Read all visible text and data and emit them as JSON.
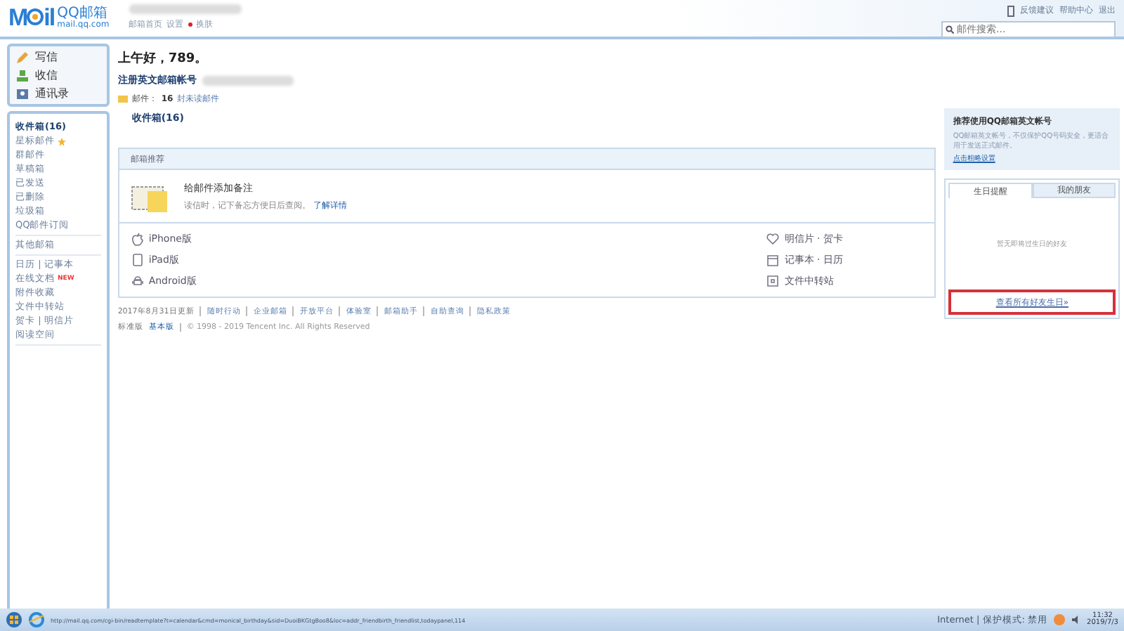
{
  "header": {
    "logo_mark": [
      "M",
      "il"
    ],
    "logo": "QQ邮箱",
    "domain": "mail.qq.com",
    "links": [
      "邮箱首页",
      "设置",
      "换肤"
    ],
    "top_links": [
      "反馈建议",
      "帮助中心",
      "退出"
    ],
    "search": {
      "placeholder": "邮件搜索..."
    }
  },
  "sidebar": {
    "actions": [
      "写信",
      "收信",
      "通讯录"
    ],
    "groups": [
      [
        {
          "label": "收件箱(16)",
          "bold": true
        },
        {
          "label": "星标邮件",
          "star": true
        },
        {
          "label": "群邮件"
        },
        {
          "label": "草稿箱"
        },
        {
          "label": "已发送"
        },
        {
          "label": "已删除"
        },
        {
          "label": "垃圾箱"
        },
        {
          "label": "QQ邮件订阅"
        }
      ],
      [
        {
          "label": "其他邮箱"
        }
      ],
      [
        {
          "label": "日历 | 记事本"
        },
        {
          "label": "在线文档",
          "badge": "NEW"
        },
        {
          "label": "附件收藏"
        },
        {
          "label": "文件中转站"
        },
        {
          "label": "贺卡 | 明信片"
        },
        {
          "label": "阅读空间"
        }
      ]
    ]
  },
  "welcome": {
    "greeting": "上午好，789。",
    "register": "注册英文邮箱帐号",
    "mail_label": "邮件：",
    "mail_count": "16",
    "unread": "封未读邮件",
    "inbox": "收件箱(16)"
  },
  "recommend": {
    "title": "邮箱推荐",
    "tip_title": "给邮件添加备注",
    "tip_text": "读信时，记下备忘方便日后查阅。",
    "tip_link": "了解详情",
    "apps": [
      {
        "label": "iPhone版",
        "kind": "phone"
      },
      {
        "label": "明信片 · 贺卡",
        "kind": "heart"
      },
      {
        "label": "iPad版",
        "kind": "tablet"
      },
      {
        "label": "记事本 · 日历",
        "kind": "calendar"
      },
      {
        "label": "Android版",
        "kind": "android"
      },
      {
        "label": "文件中转站",
        "kind": "file"
      }
    ]
  },
  "footer": {
    "links": [
      "2017年8月31日更新",
      "随时行动",
      "企业邮箱",
      "开放平台",
      "体验室",
      "邮箱助手",
      "自助查询",
      "隐私政策"
    ],
    "versions": [
      "标准版",
      "基本版"
    ],
    "copyright": "© 1998 - 2019 Tencent Inc. All Rights Reserved"
  },
  "promo": {
    "title": "推荐使用QQ邮箱英文帐号",
    "text": "QQ邮箱英文帐号，不仅保护QQ号码安全，更适合用于发送正式邮件。",
    "link": "点击粗略设置"
  },
  "birthday": {
    "tabs": [
      {
        "label": "生日提醒",
        "selected": true
      },
      {
        "label": "我的朋友",
        "selected": false
      }
    ],
    "empty": "暂无即将过生日的好友",
    "link": "查看所有好友生日»"
  },
  "taskbar": {
    "status_url": "http://mail.qq.com/cgi-bin/readtemplate?t=calendar&cmd=monical_birthday&sid=DuoiBKGtgBoo8&loc=addr_friendbirth_friendlist,todaypanel,114",
    "zone": "Internet | 保护模式: 禁用",
    "time": "11:32",
    "date": "2019/7/3"
  }
}
